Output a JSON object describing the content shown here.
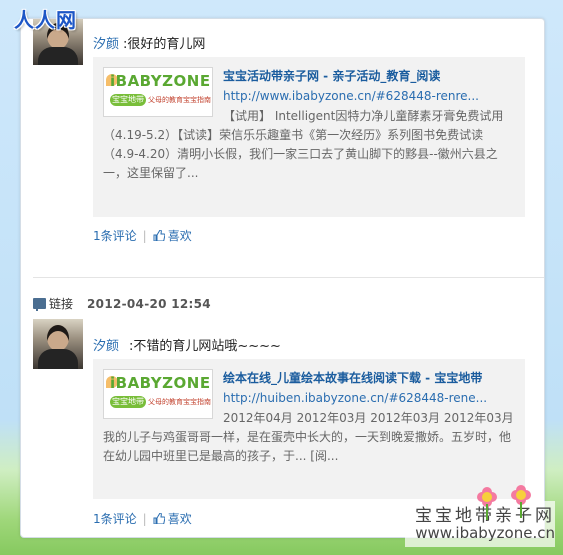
{
  "site": {
    "logo_text": "人人网"
  },
  "posts": [
    {
      "author": "汐颜",
      "status": ":很好的育儿网",
      "share": {
        "thumb_word": "iBABYZONE",
        "thumb_badge": "宝宝地带",
        "thumb_tagline": "父母的教育宝宝指南",
        "title": "宝宝活动带亲子网 - 亲子活动_教育_阅读",
        "url": "http://www.ibabyzone.cn/#628448-renre...",
        "desc_line1": "【试用】 Intelligent因特力净儿童酵素牙膏免费试用",
        "desc_rest": "（4.19-5.2）【试读】荣信乐乐趣童书《第一次经历》系列图书免费试读（4.9-4.20）清明小长假，我们一家三口去了黄山脚下的黟县--徽州六县之一，这里保留了..."
      },
      "comments": "1条评论",
      "like": "喜欢"
    },
    {
      "meta_label": "链接",
      "time": "2012-04-20 12:54",
      "author": "汐颜",
      "status": ":不错的育儿网站哦~~~~",
      "share": {
        "thumb_word": "iBABYZONE",
        "thumb_badge": "宝宝地带",
        "thumb_tagline": "父母的教育宝宝指南",
        "title": "绘本在线_儿童绘本故事在线阅读下载 - 宝宝地带",
        "url": "http://huiben.ibabyzone.cn/#628448-rene...",
        "desc_line1": "2012年04月 2012年03月 2012年03月 2012年03月",
        "desc_rest": "我的儿子与鸡蛋哥哥一样，是在蛋壳中长大的，一天到晚爱撒娇。五岁时，他在幼儿园中班里已是最高的孩子，于... [阅..."
      },
      "comments": "1条评论",
      "like": "喜欢"
    }
  ],
  "watermark": {
    "line1": "宝宝地带亲子网",
    "line2": "www.ibabyzone.cn"
  },
  "colors": {
    "link": "#2a6db0",
    "share_bg": "#f2f2f2",
    "brand": "#1d56c6"
  }
}
